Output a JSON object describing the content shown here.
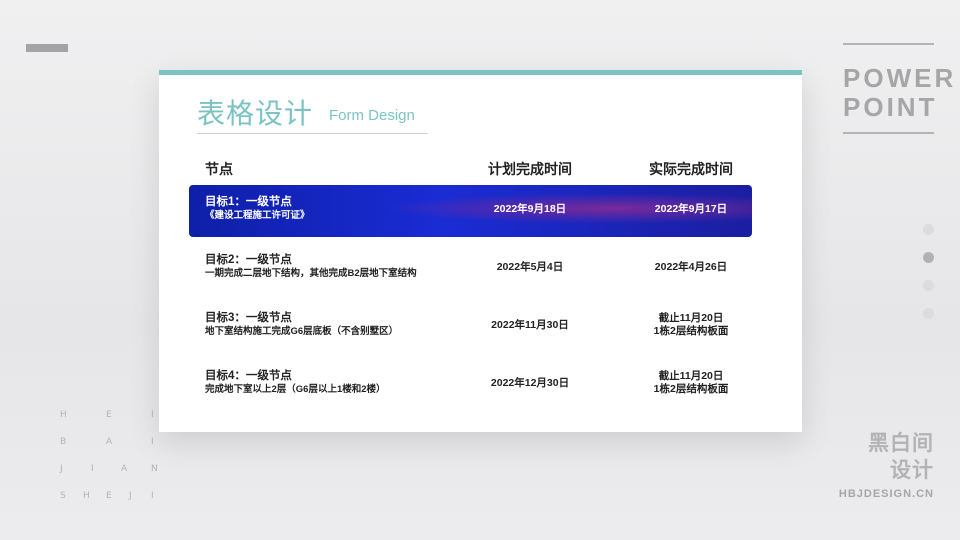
{
  "brand": {
    "power_line1": "POWER",
    "power_line2": "POINT",
    "cn_line1": "黑白间",
    "cn_line2": "设计",
    "site": "HBJDESIGN.CN",
    "letters": [
      [
        "H",
        "E",
        "I"
      ],
      [
        "B",
        "A",
        "I"
      ],
      [
        "J",
        "I",
        "A",
        "N"
      ],
      [
        "S",
        "H",
        "E",
        "J",
        "I"
      ]
    ]
  },
  "card": {
    "title_cn": "表格设计",
    "title_en": "Form Design",
    "accent_color": "#79c5c5"
  },
  "table": {
    "headers": [
      "节点",
      "计划完成时间",
      "实际完成时间"
    ],
    "rows": [
      {
        "title": "目标1：一级节点",
        "desc": "《建设工程施工许可证》",
        "plan": "2022年9月18日",
        "actual1": "2022年9月17日",
        "actual2": "",
        "highlighted": true
      },
      {
        "title": "目标2：一级节点",
        "desc": "一期完成二层地下结构，其他完成B2层地下室结构",
        "plan": "2022年5月4日",
        "actual1": "2022年4月26日",
        "actual2": "",
        "highlighted": false
      },
      {
        "title": "目标3：一级节点",
        "desc": "地下室结构施工完成G6层底板（不含别墅区）",
        "plan": "2022年11月30日",
        "actual1": "截止11月20日",
        "actual2": "1栋2层结构板面",
        "highlighted": false
      },
      {
        "title": "目标4：一级节点",
        "desc": "完成地下室以上2层（G6层以上1楼和2楼）",
        "plan": "2022年12月30日",
        "actual1": "截止11月20日",
        "actual2": "1栋2层结构板面",
        "highlighted": false
      }
    ]
  },
  "pagination": {
    "total": 4,
    "active_index": 1
  }
}
